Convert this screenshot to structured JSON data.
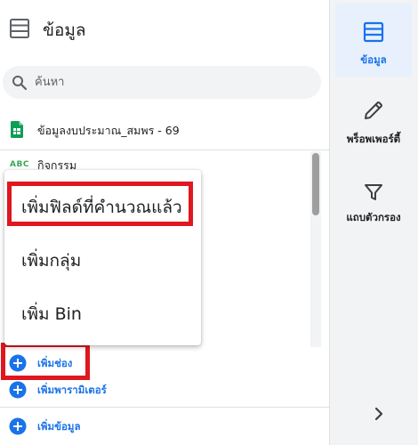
{
  "header": {
    "title": "ข้อมูล",
    "icon": "table-icon"
  },
  "search": {
    "placeholder": "ค้นหา"
  },
  "data_source": {
    "name": "ข้อมูลงบประมาณ_สมพร - 69",
    "icon": "sheets-icon"
  },
  "fields": [
    {
      "type_badge": "ABC",
      "name": "กิจกรรม"
    }
  ],
  "context_menu": {
    "items": [
      {
        "label": "เพิ่มฟิลด์ที่คำนวณแล้ว",
        "highlighted": true
      },
      {
        "label": "เพิ่มกลุ่ม",
        "highlighted": false
      },
      {
        "label": "เพิ่ม Bin",
        "highlighted": false
      }
    ]
  },
  "actions": {
    "add_dimension": "เพิ่มช่อง",
    "add_parameter": "เพิ่มพารามิเตอร์",
    "add_data": "เพิ่มข้อมูล"
  },
  "right_tabs": [
    {
      "label": "ข้อมูล",
      "icon": "table-icon",
      "active": true
    },
    {
      "label": "พร็อพเพอร์ตี้",
      "icon": "pencil-icon",
      "active": false
    },
    {
      "label": "แถบตัวกรอง",
      "icon": "filter-icon",
      "active": false
    }
  ],
  "colors": {
    "accent": "#1a73e8",
    "highlight": "#e0171f",
    "sheets_green": "#0f9d58",
    "panel_bg": "#f1f3f4"
  }
}
